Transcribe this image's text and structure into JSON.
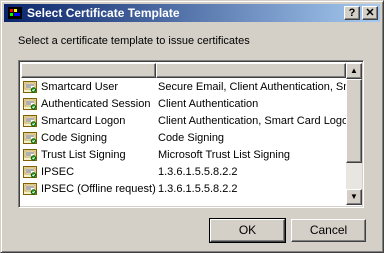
{
  "window": {
    "title": "Select Certificate Template",
    "help_label": "?",
    "close_label": "✕"
  },
  "prompt": "Select a certificate template to issue certificates",
  "columns": [
    "",
    ""
  ],
  "templates": [
    {
      "name": "Smartcard User",
      "purpose": "Secure Email, Client Authentication, Sma"
    },
    {
      "name": "Authenticated Session",
      "purpose": "Client Authentication"
    },
    {
      "name": "Smartcard Logon",
      "purpose": "Client Authentication, Smart Card Logon"
    },
    {
      "name": "Code Signing",
      "purpose": "Code Signing"
    },
    {
      "name": "Trust List Signing",
      "purpose": "Microsoft Trust List Signing"
    },
    {
      "name": "IPSEC",
      "purpose": "1.3.6.1.5.5.8.2.2"
    },
    {
      "name": "IPSEC (Offline request)",
      "purpose": "1.3.6.1.5.5.8.2.2"
    }
  ],
  "buttons": {
    "ok": "OK",
    "cancel": "Cancel"
  },
  "scrollbar": {
    "up_glyph": "▲",
    "down_glyph": "▼"
  },
  "icons": {
    "app": "certificate-authority-icon",
    "row": "certificate-template-icon"
  }
}
